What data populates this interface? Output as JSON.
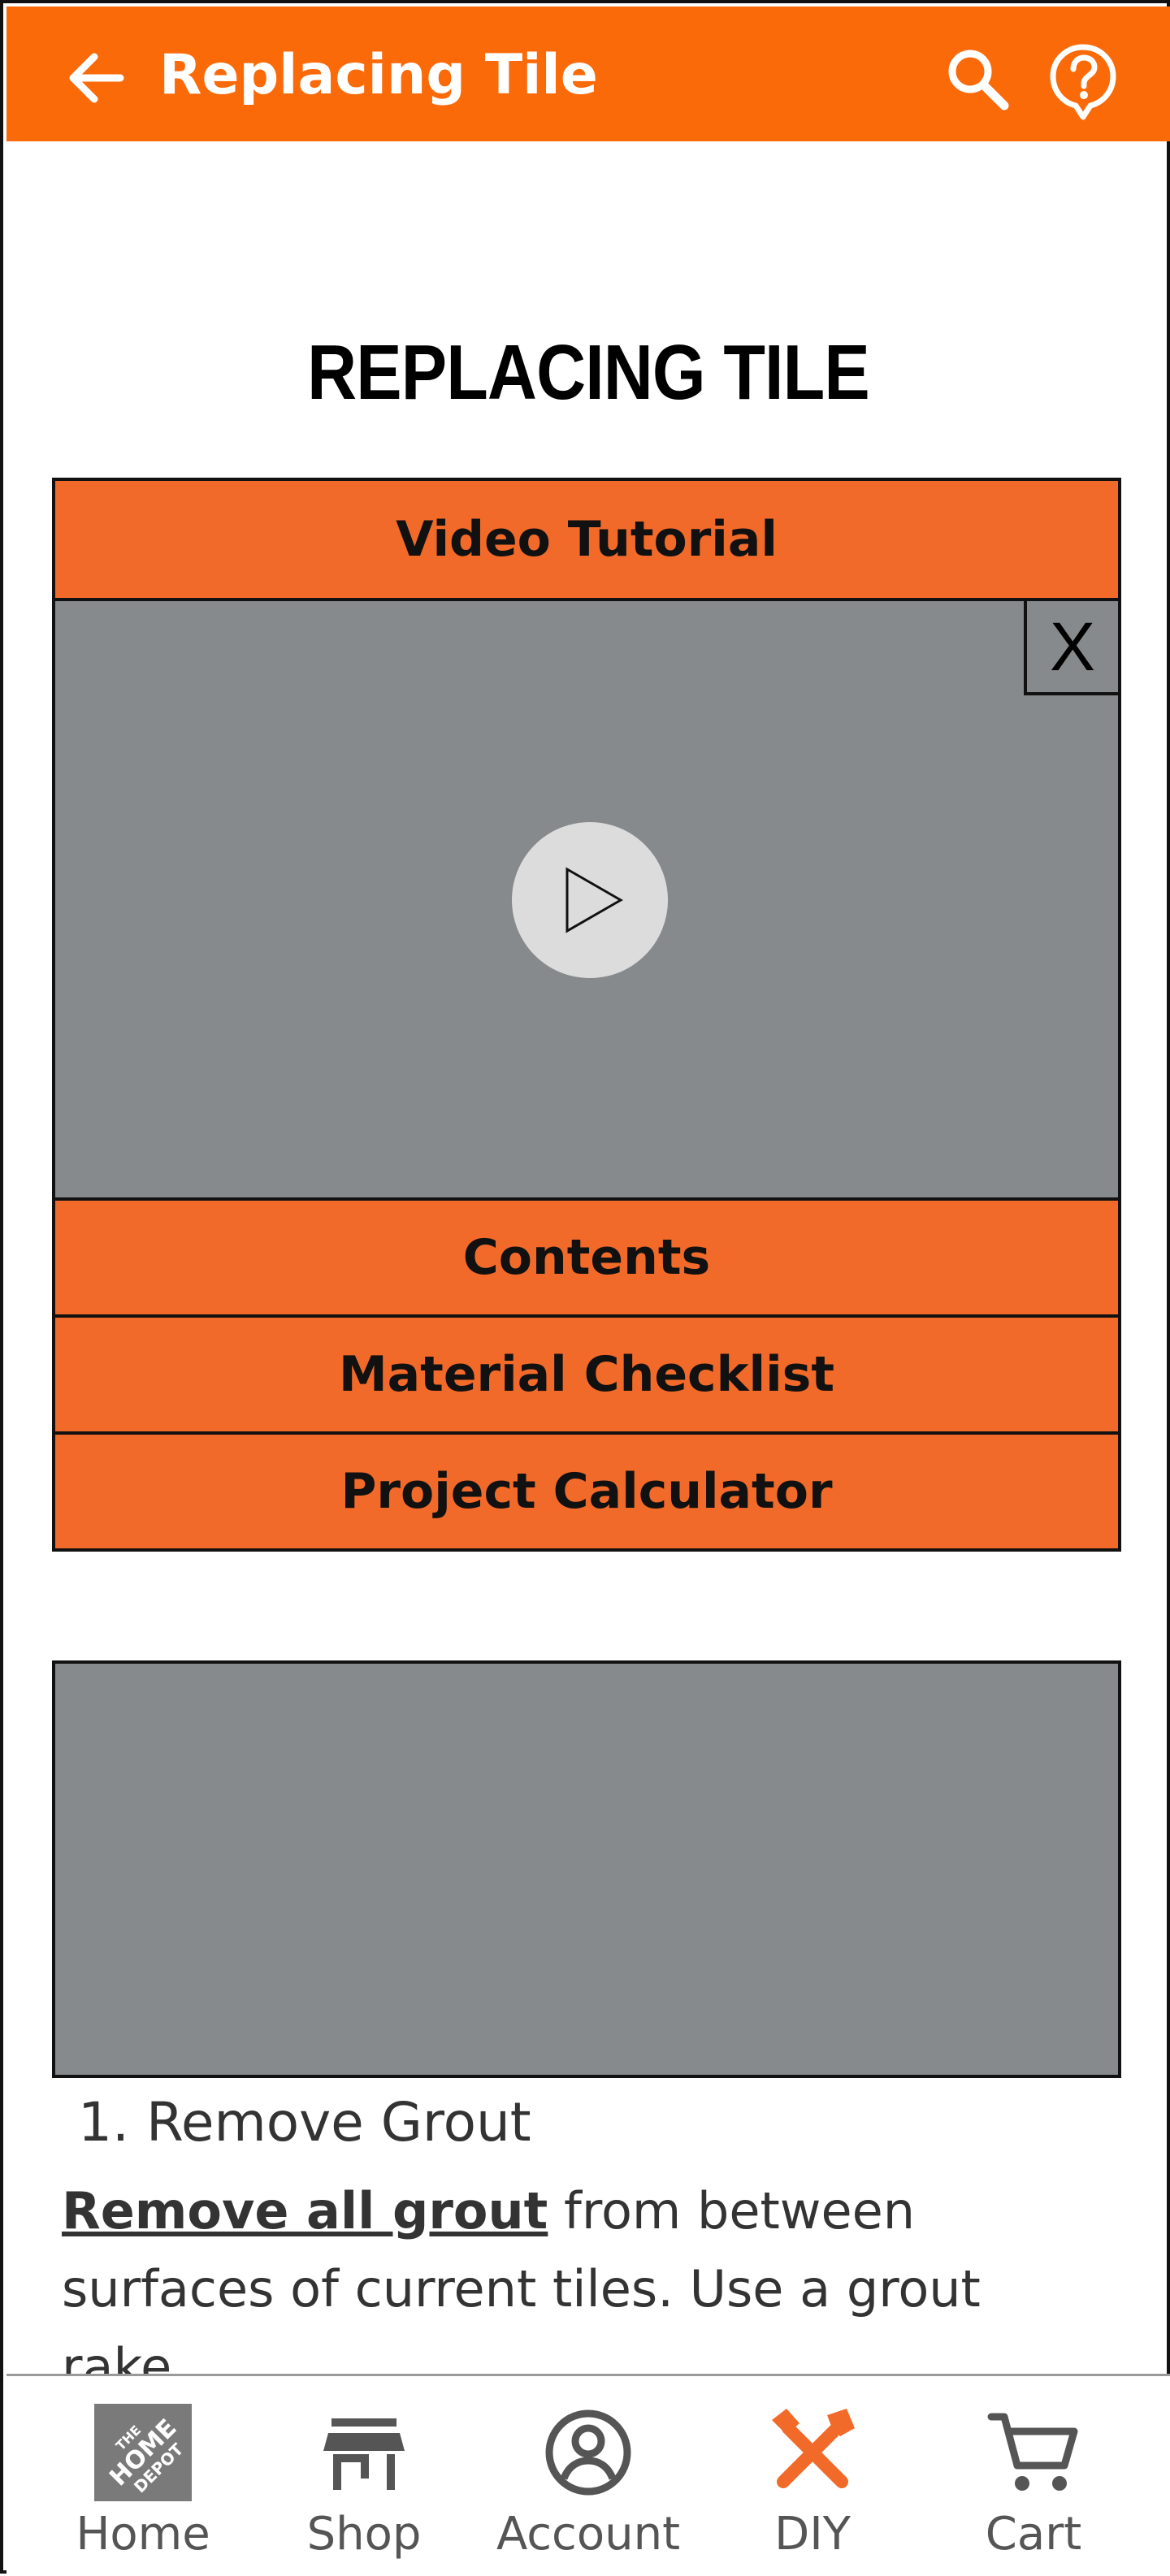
{
  "app_bar": {
    "title": "Replacing Tile",
    "back_icon": "arrow-left-icon",
    "search_icon": "search-icon",
    "help_icon": "help-icon",
    "color": "#fb6a09"
  },
  "page_title": "REPLACING TILE",
  "accordion": {
    "video_tutorial": "Video Tutorial",
    "video": {
      "close_label": "X",
      "play_icon": "play-icon"
    },
    "contents": "Contents",
    "material_checklist": "Material Checklist",
    "project_calculator": "Project Calculator",
    "color": "#f26a2a"
  },
  "step": {
    "title": "1. Remove Grout",
    "emphasis": "Remove all grout",
    "text": " from between surfaces of current tiles. Use a grout rake."
  },
  "bottom_nav": {
    "items": [
      {
        "label": "Home",
        "icon": "home-depot-logo-icon"
      },
      {
        "label": "Shop",
        "icon": "store-icon"
      },
      {
        "label": "Account",
        "icon": "account-icon"
      },
      {
        "label": "DIY",
        "icon": "tools-icon",
        "active": true
      },
      {
        "label": "Cart",
        "icon": "cart-icon"
      }
    ],
    "active_color": "#f26a2a"
  }
}
